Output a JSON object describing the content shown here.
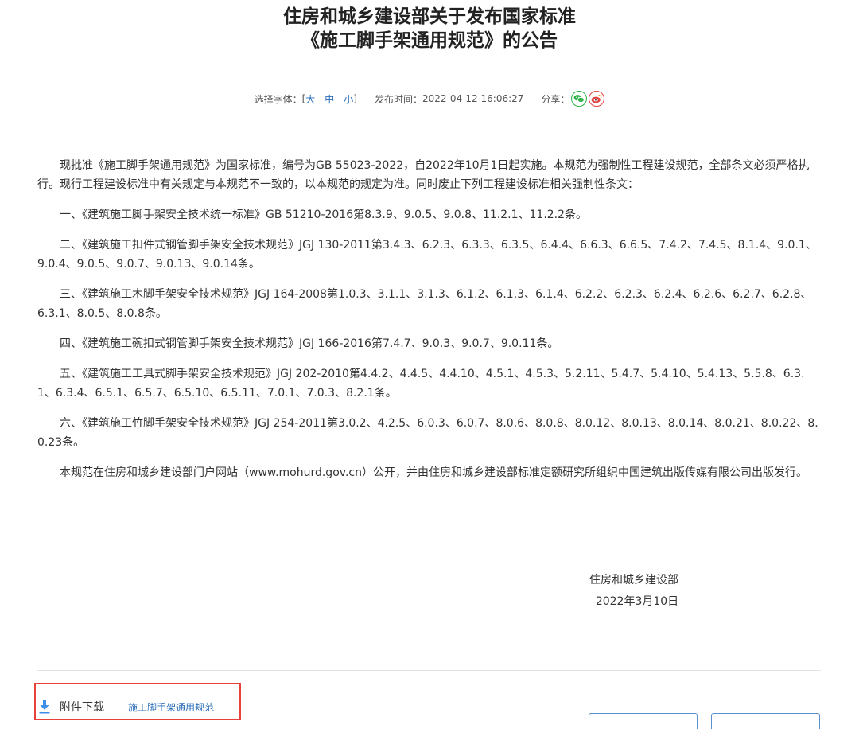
{
  "article": {
    "title_line1": "住房和城乡建设部关于发布国家标准",
    "title_line2": "《施工脚手架通用规范》的公告"
  },
  "meta": {
    "font_label": "选择字体：",
    "bracket_open": "[",
    "font_large": "大",
    "sep1": " - ",
    "font_medium": "中",
    "sep2": " - ",
    "font_small": "小",
    "bracket_close": "]",
    "publish_label": "发布时间：",
    "publish_time": "2022-04-12 16:06:27",
    "share_label": "分享："
  },
  "paragraphs": [
    "现批准《施工脚手架通用规范》为国家标准，编号为GB 55023-2022，自2022年10月1日起实施。本规范为强制性工程建设规范，全部条文必须严格执行。现行工程建设标准中有关规定与本规范不一致的，以本规范的规定为准。同时废止下列工程建设标准相关强制性条文：",
    "一、《建筑施工脚手架安全技术统一标准》GB 51210-2016第8.3.9、9.0.5、9.0.8、11.2.1、11.2.2条。",
    "二、《建筑施工扣件式钢管脚手架安全技术规范》JGJ 130-2011第3.4.3、6.2.3、6.3.3、6.3.5、6.4.4、6.6.3、6.6.5、7.4.2、7.4.5、8.1.4、9.0.1、9.0.4、9.0.5、9.0.7、9.0.13、9.0.14条。",
    "三、《建筑施工木脚手架安全技术规范》JGJ 164-2008第1.0.3、3.1.1、3.1.3、6.1.2、6.1.3、6.1.4、6.2.2、6.2.3、6.2.4、6.2.6、6.2.7、6.2.8、6.3.1、8.0.5、8.0.8条。",
    "四、《建筑施工碗扣式钢管脚手架安全技术规范》JGJ 166-2016第7.4.7、9.0.3、9.0.7、9.0.11条。",
    "五、《建筑施工工具式脚手架安全技术规范》JGJ 202-2010第4.4.2、4.4.5、4.4.10、4.5.1、4.5.3、5.2.11、5.4.7、5.4.10、5.4.13、5.5.8、6.3.1、6.3.4、6.5.1、6.5.7、6.5.10、6.5.11、7.0.1、7.0.3、8.2.1条。",
    "六、《建筑施工竹脚手架安全技术规范》JGJ 254-2011第3.0.2、4.2.5、6.0.3、6.0.7、8.0.6、8.0.8、8.0.12、8.0.13、8.0.14、8.0.21、8.0.22、8.0.23条。",
    "本规范在住房和城乡建设部门户网站（www.mohurd.gov.cn）公开，并由住房和城乡建设部标准定额研究所组织中国建筑出版传媒有限公司出版发行。"
  ],
  "signature": {
    "org": "住房和城乡建设部",
    "date": "2022年3月10日"
  },
  "attachment": {
    "label": "附件下载",
    "file": "施工脚手架通用规范"
  },
  "colors": {
    "link": "#2a6cb8",
    "highlight": "#e8413c",
    "wechat": "#2fb34a",
    "weibo": "#e2413f"
  }
}
